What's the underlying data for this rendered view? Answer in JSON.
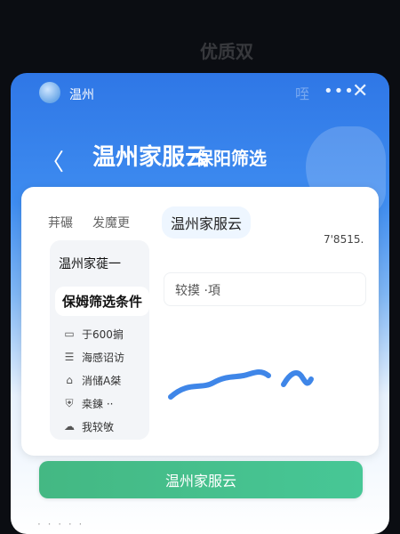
{
  "background": {
    "top_text": "优质双"
  },
  "header": {
    "title": "温州",
    "ghost": "咥",
    "more": "•••",
    "close": "✕"
  },
  "hero": {
    "back": "〈",
    "title": "温州家服云",
    "subtitle": "保阳筛选"
  },
  "card": {
    "tabs": [
      {
        "label": "荓碾"
      },
      {
        "label": "发魔更"
      },
      {
        "label": "温州家服云"
      }
    ],
    "hint_right": "7'8515.",
    "left_col": {
      "line1": "温州家蓰一",
      "line2": "保姆筛选条件",
      "items": [
        {
          "icon": "▭",
          "label": "于600掮"
        },
        {
          "icon": "☰",
          "label": "海感诏访"
        },
        {
          "icon": "⌂",
          "label": "消储A桀"
        },
        {
          "icon": "⛨",
          "label": "桒鍊 ··"
        },
        {
          "icon": "☁",
          "label": "我较敂"
        }
      ]
    },
    "search_placeholder": "较摸 ·項"
  },
  "cta": {
    "label": "温州家服云"
  },
  "bottom_peek": "· · · · ·",
  "colors": {
    "header_blue": "#2f77e6",
    "cta_green": "#44b883",
    "wave_blue": "#3f86e8"
  },
  "icons": {
    "logo": "avatar-icon",
    "back": "chevron-left-icon",
    "more": "more-icon",
    "close": "close-icon",
    "wave": "wave-icon"
  }
}
